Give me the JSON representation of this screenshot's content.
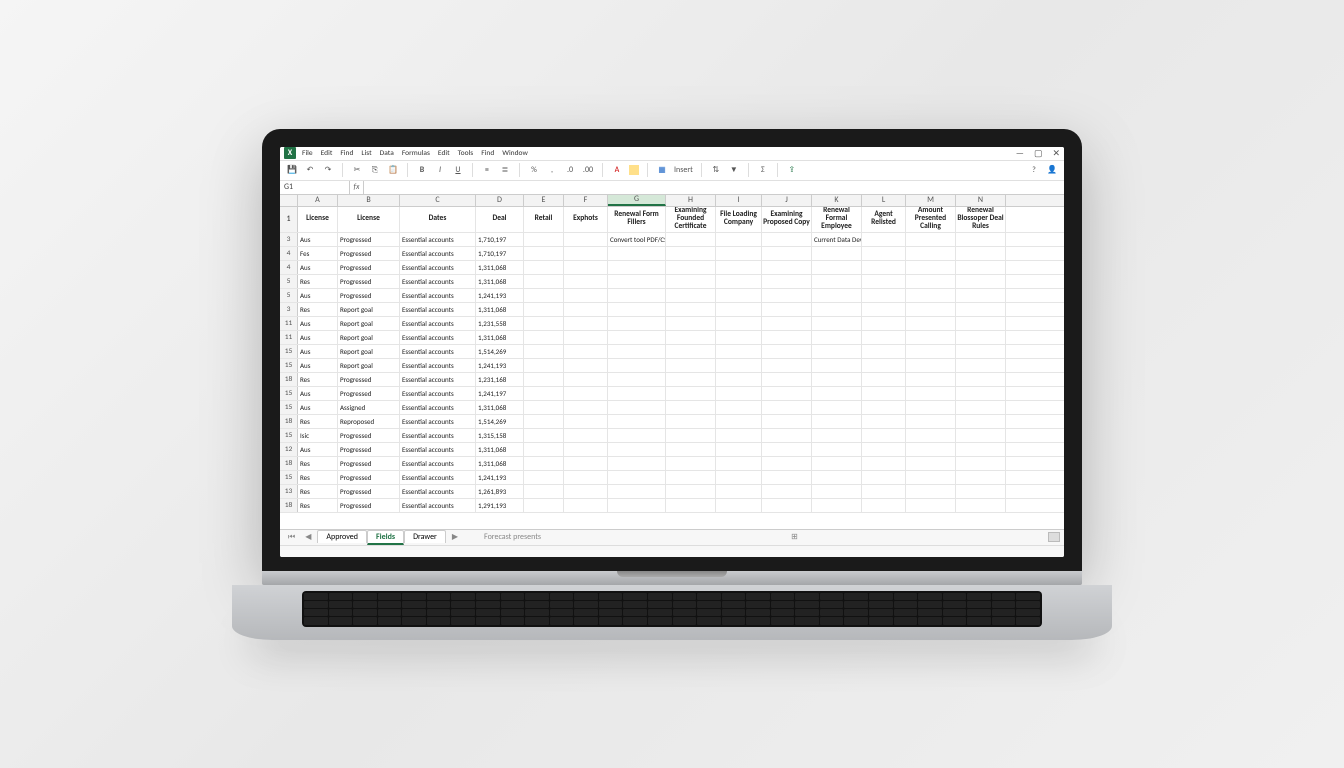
{
  "menus": [
    "File",
    "Edit",
    "Find",
    "List",
    "Data",
    "Formulas",
    "Edit",
    "Tools",
    "Find",
    "Window"
  ],
  "window_controls": {
    "min": "—",
    "max": "▢",
    "close": "✕"
  },
  "toolbar_groups": {
    "left": [
      "save",
      "undo",
      "redo"
    ],
    "font": [
      "bold",
      "italic",
      "underline"
    ],
    "align": [
      "left",
      "center",
      "right"
    ],
    "num": [
      "percent",
      "comma",
      "decimal"
    ],
    "color": [
      "font-color",
      "fill-color"
    ],
    "insert_label": "Insert"
  },
  "namebox": "G1",
  "columns": [
    "A",
    "B",
    "C",
    "D",
    "E",
    "F",
    "G",
    "H",
    "I",
    "J",
    "K",
    "L",
    "M",
    "N"
  ],
  "col_widths": [
    "wA",
    "wB",
    "wC",
    "wD",
    "wE",
    "wF",
    "wG1",
    "wG2",
    "wG3",
    "wG4",
    "wG5",
    "wG6",
    "wG7",
    "wG8"
  ],
  "active_col": "G",
  "header_row_index": 1,
  "headers": [
    "License",
    "License",
    "Dates",
    "Deal",
    "Retail",
    "Exphots",
    "Renewal Form Fillers",
    "Examining Founded Certificate",
    "File Loading Company",
    "Examining Proposed Copy",
    "Renewal Formal Employee",
    "Agent Relisted",
    "Amount Presented Calling",
    "Renewal Blossoper Deal Rules"
  ],
  "rows": [
    {
      "n": 3,
      "c": [
        "Aus",
        "Progressed",
        "Essential accounts",
        "1,710,197",
        "",
        "",
        "Convert tool PDF/CSV",
        "",
        "",
        "",
        "Current Data Development DOCUMENT",
        "",
        "",
        ""
      ]
    },
    {
      "n": 4,
      "c": [
        "Fes",
        "Progressed",
        "Essential accounts",
        "1,710,197",
        "",
        "",
        "",
        "",
        "",
        "",
        "",
        "",
        "",
        ""
      ]
    },
    {
      "n": 4,
      "c": [
        "Aus",
        "Progressed",
        "Essential accounts",
        "1,311,068",
        "",
        "",
        "",
        "",
        "",
        "",
        "",
        "",
        "",
        ""
      ]
    },
    {
      "n": 5,
      "c": [
        "Res",
        "Progressed",
        "Essential accounts",
        "1,311,068",
        "",
        "",
        "",
        "",
        "",
        "",
        "",
        "",
        "",
        ""
      ]
    },
    {
      "n": 5,
      "c": [
        "Aus",
        "Progressed",
        "Essential accounts",
        "1,241,193",
        "",
        "",
        "",
        "",
        "",
        "",
        "",
        "",
        "",
        ""
      ]
    },
    {
      "n": 3,
      "c": [
        "Res",
        "Report goal",
        "Essential accounts",
        "1,311,068",
        "",
        "",
        "",
        "",
        "",
        "",
        "",
        "",
        "",
        ""
      ]
    },
    {
      "n": 11,
      "c": [
        "Aus",
        "Report goal",
        "Essential accounts",
        "1,231,558",
        "",
        "",
        "",
        "",
        "",
        "",
        "",
        "",
        "",
        ""
      ]
    },
    {
      "n": 11,
      "c": [
        "Aus",
        "Report goal",
        "Essential accounts",
        "1,311,068",
        "",
        "",
        "",
        "",
        "",
        "",
        "",
        "",
        "",
        ""
      ]
    },
    {
      "n": 15,
      "c": [
        "Aus",
        "Report goal",
        "Essential accounts",
        "1,514,269",
        "",
        "",
        "",
        "",
        "",
        "",
        "",
        "",
        "",
        ""
      ]
    },
    {
      "n": 15,
      "c": [
        "Aus",
        "Report goal",
        "Essential accounts",
        "1,241,193",
        "",
        "",
        "",
        "",
        "",
        "",
        "",
        "",
        "",
        ""
      ]
    },
    {
      "n": 18,
      "c": [
        "Res",
        "Progressed",
        "Essential accounts",
        "1,231,168",
        "",
        "",
        "",
        "",
        "",
        "",
        "",
        "",
        "",
        ""
      ]
    },
    {
      "n": 15,
      "c": [
        "Aus",
        "Progressed",
        "Essential accounts",
        "1,241,197",
        "",
        "",
        "",
        "",
        "",
        "",
        "",
        "",
        "",
        ""
      ]
    },
    {
      "n": 15,
      "c": [
        "Aus",
        "Assigned",
        "Essential accounts",
        "1,311,068",
        "",
        "",
        "",
        "",
        "",
        "",
        "",
        "",
        "",
        ""
      ]
    },
    {
      "n": 18,
      "c": [
        "Res",
        "Reproposed",
        "Essential accounts",
        "1,514,269",
        "",
        "",
        "",
        "",
        "",
        "",
        "",
        "",
        "",
        ""
      ]
    },
    {
      "n": 15,
      "c": [
        "Isic",
        "Progressed",
        "Essential accounts",
        "1,315,158",
        "",
        "",
        "",
        "",
        "",
        "",
        "",
        "",
        "",
        ""
      ]
    },
    {
      "n": 12,
      "c": [
        "Aus",
        "Progressed",
        "Essential accounts",
        "1,311,068",
        "",
        "",
        "",
        "",
        "",
        "",
        "",
        "",
        "",
        ""
      ]
    },
    {
      "n": 18,
      "c": [
        "Res",
        "Progressed",
        "Essential accounts",
        "1,311,068",
        "",
        "",
        "",
        "",
        "",
        "",
        "",
        "",
        "",
        ""
      ]
    },
    {
      "n": 15,
      "c": [
        "Res",
        "Progressed",
        "Essential accounts",
        "1,241,193",
        "",
        "",
        "",
        "",
        "",
        "",
        "",
        "",
        "",
        ""
      ]
    },
    {
      "n": 13,
      "c": [
        "Res",
        "Progressed",
        "Essential accounts",
        "1,261,893",
        "",
        "",
        "",
        "",
        "",
        "",
        "",
        "",
        "",
        ""
      ]
    },
    {
      "n": 18,
      "c": [
        "Res",
        "Progressed",
        "Essential accounts",
        "1,291,193",
        "",
        "",
        "",
        "",
        "",
        "",
        "",
        "",
        "",
        ""
      ]
    }
  ],
  "sheet_tabs": {
    "nav": [
      "⏮",
      "◀"
    ],
    "tabs": [
      "Approved",
      "Fields",
      "Drawer"
    ],
    "active": 1,
    "more": "▶",
    "right_info": "Forecast presents"
  }
}
